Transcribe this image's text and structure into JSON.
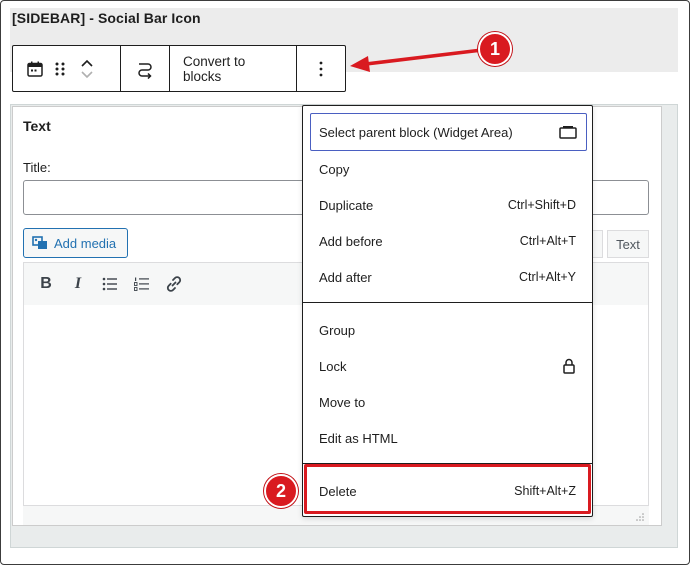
{
  "widget_area": {
    "title": "[SIDEBAR] - Social Bar Icon"
  },
  "block_toolbar": {
    "block_icon": "calendar-icon",
    "drag_icon": "drag-handle-icon",
    "move_up_icon": "chevron-up-icon",
    "move_down_icon": "chevron-down-icon",
    "transform_icon": "transform-icon",
    "convert_label": "Convert to blocks",
    "options_icon": "more-vertical-icon"
  },
  "text_widget": {
    "heading": "Text",
    "title_label": "Title:",
    "title_value": "",
    "add_media_label": "Add media",
    "tab_text": "Text",
    "editor_buttons": [
      "bold-icon",
      "italic-icon",
      "bulleted-list-icon",
      "numbered-list-icon",
      "link-icon"
    ],
    "bold_glyph": "B",
    "italic_glyph": "I"
  },
  "dropdown": {
    "group1": [
      {
        "label": "Select parent block (Widget Area)",
        "shortcut": "",
        "icon": "widget-area-icon",
        "selected": true
      },
      {
        "label": "Copy",
        "shortcut": ""
      },
      {
        "label": "Duplicate",
        "shortcut": "Ctrl+Shift+D"
      },
      {
        "label": "Add before",
        "shortcut": "Ctrl+Alt+T"
      },
      {
        "label": "Add after",
        "shortcut": "Ctrl+Alt+Y"
      }
    ],
    "group2": [
      {
        "label": "Group",
        "shortcut": ""
      },
      {
        "label": "Lock",
        "shortcut": "",
        "icon": "lock-icon"
      },
      {
        "label": "Move to",
        "shortcut": ""
      },
      {
        "label": "Edit as HTML",
        "shortcut": ""
      }
    ],
    "group3": [
      {
        "label": "Delete",
        "shortcut": "Shift+Alt+Z"
      }
    ]
  },
  "annotations": {
    "callout_1": "1",
    "callout_2": "2",
    "highlight_color": "#d91a20"
  }
}
